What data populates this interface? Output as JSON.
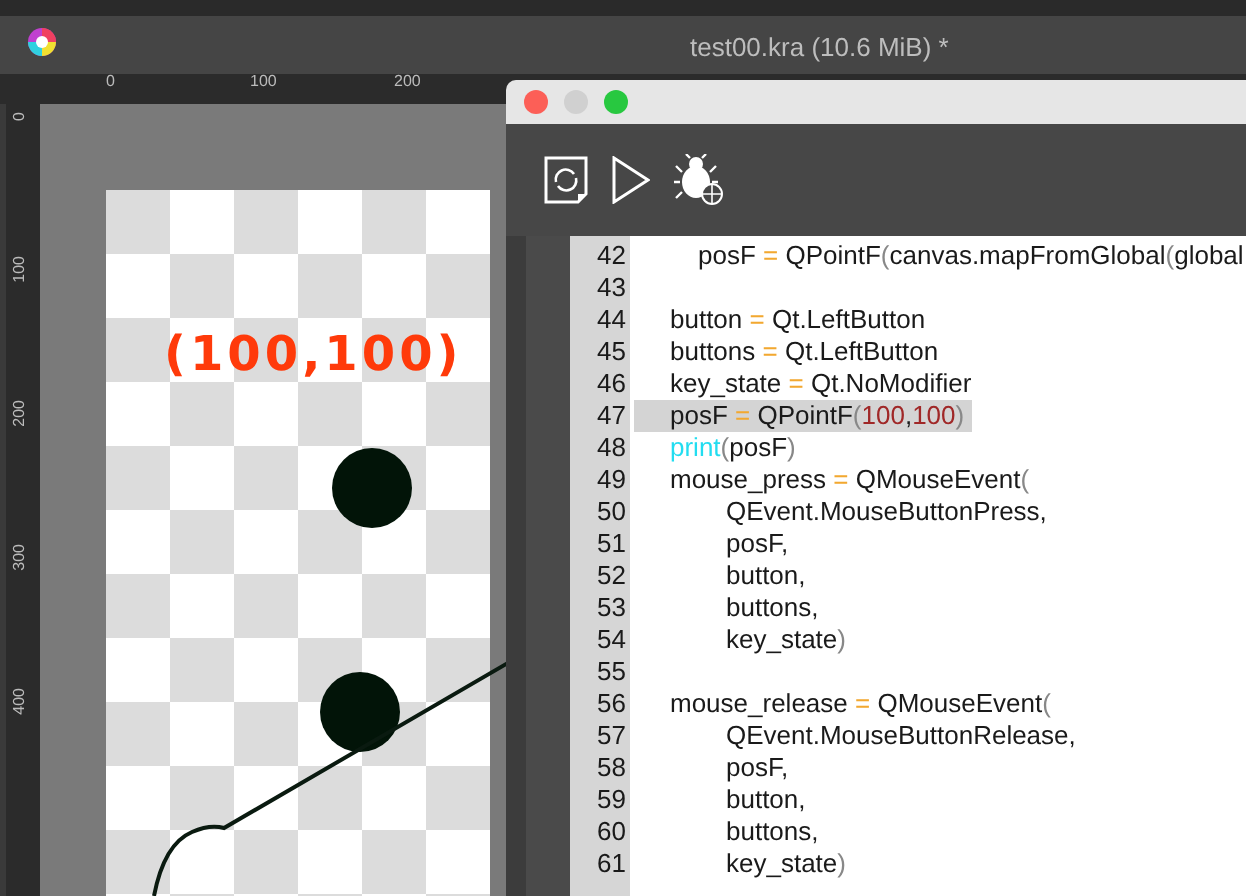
{
  "app": {
    "title": "test00.kra (10.6 MiB) *"
  },
  "rulers": {
    "horizontal": [
      "0",
      "100",
      "200"
    ],
    "vertical": [
      "0",
      "100",
      "200",
      "300",
      "400"
    ]
  },
  "canvas": {
    "annotation": "(100,100)"
  },
  "script_window": {
    "code_lines": [
      {
        "number": "42",
        "kind": "nested",
        "selected": false,
        "tokens": [
          {
            "text": "posF ",
            "kind": "plain"
          },
          {
            "text": "=",
            "kind": "op"
          },
          {
            "text": " QPointF",
            "kind": "plain"
          },
          {
            "text": "(",
            "kind": "paren"
          },
          {
            "text": "canvas.mapFromGlobal",
            "kind": "plain"
          },
          {
            "text": "(",
            "kind": "paren"
          },
          {
            "text": "global",
            "kind": "plain"
          }
        ]
      },
      {
        "number": "43",
        "selected": false
      },
      {
        "number": "44",
        "kind": "statement",
        "selected": false,
        "tokens": [
          {
            "text": "button ",
            "kind": "plain"
          },
          {
            "text": "=",
            "kind": "op"
          },
          {
            "text": " Qt.LeftButton",
            "kind": "plain"
          }
        ]
      },
      {
        "number": "45",
        "kind": "statement",
        "selected": false,
        "tokens": [
          {
            "text": "buttons ",
            "kind": "plain"
          },
          {
            "text": "=",
            "kind": "op"
          },
          {
            "text": " Qt.LeftButton",
            "kind": "plain"
          }
        ]
      },
      {
        "number": "46",
        "kind": "statement",
        "selected": false,
        "tokens": [
          {
            "text": "key_state ",
            "kind": "plain"
          },
          {
            "text": "=",
            "kind": "op"
          },
          {
            "text": " Qt.NoModifier",
            "kind": "plain"
          }
        ]
      },
      {
        "number": "47",
        "kind": "statement",
        "selected": true,
        "tokens": [
          {
            "text": "posF ",
            "kind": "plain"
          },
          {
            "text": "=",
            "kind": "op"
          },
          {
            "text": " QPointF",
            "kind": "plain"
          },
          {
            "text": "(",
            "kind": "paren"
          },
          {
            "text": "100",
            "kind": "number"
          },
          {
            "text": ",",
            "kind": "plain"
          },
          {
            "text": "100",
            "kind": "number"
          },
          {
            "text": ")",
            "kind": "paren"
          }
        ]
      },
      {
        "number": "48",
        "kind": "statement",
        "selected": false,
        "tokens": [
          {
            "text": "print",
            "kind": "builtin"
          },
          {
            "text": "(",
            "kind": "paren"
          },
          {
            "text": "posF",
            "kind": "plain"
          },
          {
            "text": ")",
            "kind": "paren"
          }
        ]
      },
      {
        "number": "49",
        "kind": "statement",
        "selected": false,
        "tokens": [
          {
            "text": "mouse_press ",
            "kind": "plain"
          },
          {
            "text": "=",
            "kind": "op"
          },
          {
            "text": " QMouseEvent",
            "kind": "plain"
          },
          {
            "text": "(",
            "kind": "paren"
          }
        ]
      },
      {
        "number": "50",
        "kind": "continuation",
        "selected": false,
        "tokens": [
          {
            "text": "QEvent.MouseButtonPress,",
            "kind": "plain"
          }
        ]
      },
      {
        "number": "51",
        "kind": "continuation",
        "selected": false,
        "tokens": [
          {
            "text": "posF,",
            "kind": "plain"
          }
        ]
      },
      {
        "number": "52",
        "kind": "continuation",
        "selected": false,
        "tokens": [
          {
            "text": "button,",
            "kind": "plain"
          }
        ]
      },
      {
        "number": "53",
        "kind": "continuation",
        "selected": false,
        "tokens": [
          {
            "text": "buttons,",
            "kind": "plain"
          }
        ]
      },
      {
        "number": "54",
        "kind": "continuation",
        "selected": false,
        "tokens": [
          {
            "text": "key_state",
            "kind": "plain"
          },
          {
            "text": ")",
            "kind": "paren"
          }
        ]
      },
      {
        "number": "55",
        "selected": false
      },
      {
        "number": "56",
        "kind": "statement",
        "selected": false,
        "tokens": [
          {
            "text": "mouse_release ",
            "kind": "plain"
          },
          {
            "text": "=",
            "kind": "op"
          },
          {
            "text": " QMouseEvent",
            "kind": "plain"
          },
          {
            "text": "(",
            "kind": "paren"
          }
        ]
      },
      {
        "number": "57",
        "kind": "continuation",
        "selected": false,
        "tokens": [
          {
            "text": "QEvent.MouseButtonRelease,",
            "kind": "plain"
          }
        ]
      },
      {
        "number": "58",
        "kind": "continuation",
        "selected": false,
        "tokens": [
          {
            "text": "posF,",
            "kind": "plain"
          }
        ]
      },
      {
        "number": "59",
        "kind": "continuation",
        "selected": false,
        "tokens": [
          {
            "text": "button,",
            "kind": "plain"
          }
        ]
      },
      {
        "number": "60",
        "kind": "continuation",
        "selected": false,
        "tokens": [
          {
            "text": "buttons,",
            "kind": "plain"
          }
        ]
      },
      {
        "number": "61",
        "kind": "continuation",
        "selected": false,
        "tokens": [
          {
            "text": "key_state",
            "kind": "plain"
          },
          {
            "text": ")",
            "kind": "paren"
          }
        ]
      }
    ]
  }
}
